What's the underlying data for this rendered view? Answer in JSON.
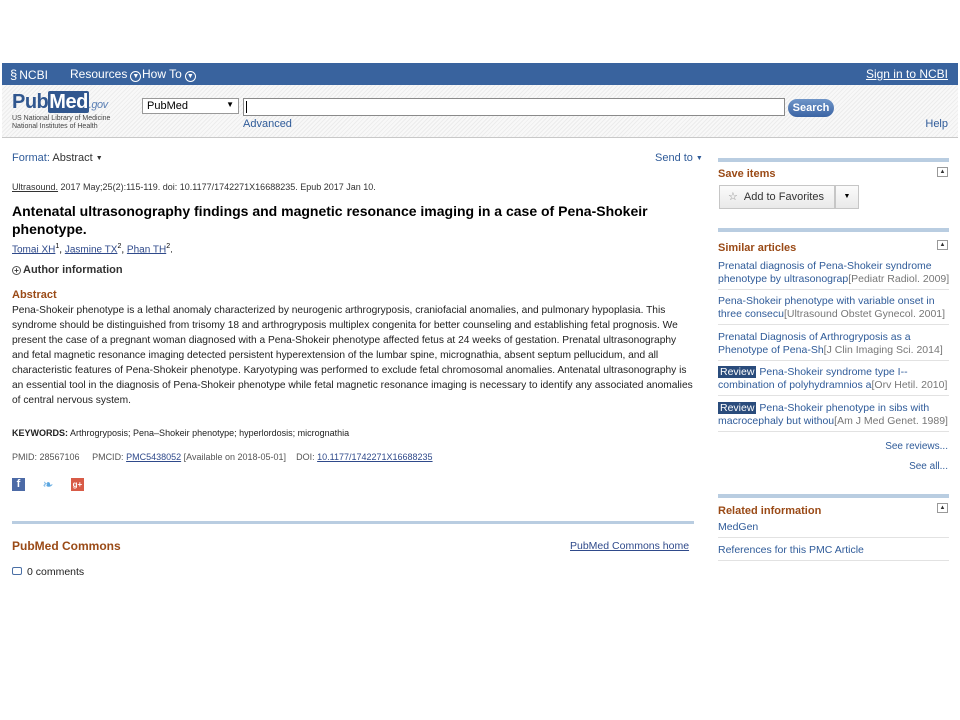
{
  "ncbi_bar": {
    "logo": "NCBI",
    "resources": "Resources",
    "howto": "How To",
    "signin": "Sign in to NCBI"
  },
  "search": {
    "logo_pub": "Pub",
    "logo_med": "Med",
    "logo_gov": ".gov",
    "sub_line1": "US National Library of Medicine",
    "sub_line2": "National Institutes of Health",
    "db_value": "PubMed",
    "term_value": "",
    "button": "Search",
    "advanced": "Advanced",
    "help": "Help"
  },
  "article": {
    "format_label": "Format:",
    "format_value": "Abstract",
    "send_to": "Send to",
    "journal": "Ultrasound.",
    "citation_rest": " 2017 May;25(2):115-119. doi: 10.1177/1742271X16688235. Epub 2017 Jan 10.",
    "title": "Antenatal ultrasonography findings and magnetic resonance imaging in a case of Pena-Shokeir phenotype.",
    "authors": [
      {
        "name": "Tomai XH",
        "sup": "1"
      },
      {
        "name": "Jasmine TX",
        "sup": "2"
      },
      {
        "name": "Phan TH",
        "sup": "2"
      }
    ],
    "author_info": "Author information",
    "abstract_heading": "Abstract",
    "abstract_text": "Pena-Shokeir phenotype is a lethal anomaly characterized by neurogenic arthrogryposis, craniofacial anomalies, and pulmonary hypoplasia. This syndrome should be distinguished from trisomy 18 and arthrogryposis multiplex congenita for better counseling and establishing fetal prognosis. We present the case of a pregnant woman diagnosed with a Pena-Shokeir phenotype affected fetus at 24 weeks of gestation. Prenatal ultrasonography and fetal magnetic resonance imaging detected persistent hyperextension of the lumbar spine, micrognathia, absent septum pellucidum, and all characteristic features of Pena-Shokeir phenotype. Karyotyping was performed to exclude fetal chromosomal anomalies. Antenatal ultrasonography is an essential tool in the diagnosis of Pena-Shokeir phenotype while fetal magnetic resonance imaging is necessary to identify any associated anomalies of central nervous system.",
    "keywords_label": "KEYWORDS:",
    "keywords": "Arthrogryposis; Pena–Shokeir phenotype; hyperlordosis; micrognathia",
    "pmid_label": "PMID: 28567106",
    "pmcid_label": "PMCID:",
    "pmcid": "PMC5438052",
    "pmc_avail": "[Available on 2018-05-01]",
    "doi_label": "DOI:",
    "doi": "10.1177/1742271X16688235"
  },
  "social": {
    "facebook_icon": "f",
    "twitter_icon": "❧",
    "gplus_icon": "g+"
  },
  "commons": {
    "heading": "PubMed Commons",
    "home_link": "PubMed Commons home",
    "comments": "0 comments"
  },
  "sidebar": {
    "save_items": "Save items",
    "add_favorites": "Add to Favorites",
    "similar_heading": "Similar articles",
    "similar": [
      {
        "review": "",
        "line1": "Prenatal diagnosis of Pena-Shokeir syndrome",
        "line2": "phenotype by ultrasonograp",
        "source": "[Pediatr Radiol. 2009]"
      },
      {
        "review": "",
        "line1": "Pena-Shokeir phenotype with variable onset in",
        "line2": "three consecu",
        "source": "[Ultrasound Obstet Gynecol. 2001]"
      },
      {
        "review": "",
        "line1": "Prenatal Diagnosis of Arthrogryposis as a",
        "line2": "Phenotype of Pena-Sh",
        "source": "[J Clin Imaging Sci. 2014]"
      },
      {
        "review": "Review",
        "line1": " Pena-Shokeir syndrome type I--",
        "line2": "combination of polyhydramnios a",
        "source": "[Orv Hetil. 2010]"
      },
      {
        "review": "Review",
        "line1": " Pena-Shokeir phenotype in sibs with",
        "line2": "macrocephaly but withou",
        "source": "[Am J Med Genet. 1989]"
      }
    ],
    "see_reviews": "See reviews...",
    "see_all": "See all...",
    "related_heading": "Related information",
    "related": [
      "MedGen",
      "References for this PMC Article"
    ]
  }
}
